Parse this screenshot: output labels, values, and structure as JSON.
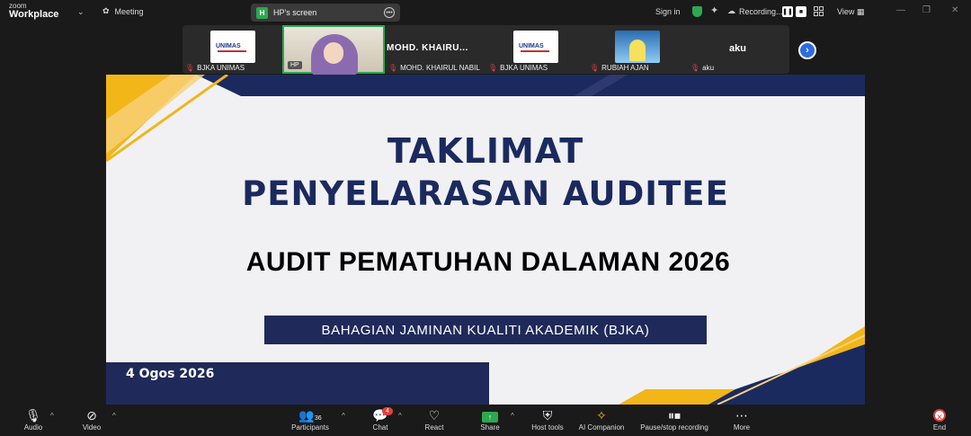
{
  "app": {
    "logo_line1": "zoom",
    "logo_line2": "Workplace",
    "meeting_label": "Meeting"
  },
  "share_indicator": {
    "badge": "H",
    "label": "HP's screen"
  },
  "topbar": {
    "signin": "Sign in",
    "recording": "Recording...",
    "view": "View"
  },
  "participants": [
    {
      "name": "BJKA UNIMAS",
      "muted": true
    },
    {
      "name": "HP",
      "muted": false,
      "active_speaker": true
    },
    {
      "name": "MOHD. KHAIRUL NABIL",
      "display": "MOHD.  KHAIRU...",
      "muted": true
    },
    {
      "name": "BJKA UNIMAS",
      "muted": true
    },
    {
      "name": "RUBIAH AJAN",
      "muted": true
    },
    {
      "name": "aku",
      "display": "aku",
      "muted": true
    }
  ],
  "logo_text": "UNIMAS",
  "slide": {
    "title_line1": "TAKLIMAT",
    "title_line2": "PENYELARASAN AUDITEE",
    "subtitle": "AUDIT PEMATUHAN DALAMAN 2026",
    "department": "BAHAGIAN JAMINAN KUALITI AKADEMIK (BJKA)",
    "date": "4 Ogos 2026",
    "colors": {
      "navy": "#1b2a5e",
      "gold": "#f2b619",
      "background": "#f1f1f4"
    }
  },
  "toolbar": {
    "audio": "Audio",
    "video": "Video",
    "participants": "Participants",
    "participants_count": "36",
    "chat": "Chat",
    "chat_badge": "4",
    "react": "React",
    "share": "Share",
    "host_tools": "Host tools",
    "ai_companion": "AI Companion",
    "recording": "Pause/stop recording",
    "more": "More",
    "end": "End"
  }
}
